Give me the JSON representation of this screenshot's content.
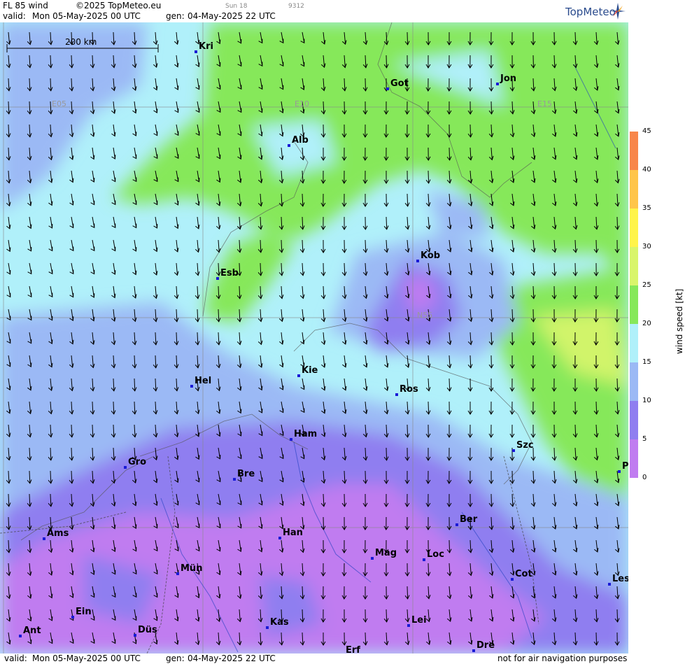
{
  "header": {
    "product": "FL 85 wind",
    "copyright": "©2025 TopMeteo.eu",
    "model_info": "Sun 18",
    "code": "9312",
    "valid_label": "valid:",
    "valid_value": "Mon  05-May-2025  00 UTC",
    "gen_label": "gen:",
    "gen_value": "04-May-2025 22 UTC",
    "logo_text": "TopMeteo"
  },
  "footer": {
    "valid_label": "valid:",
    "valid_value": "Mon  05-May-2025  00 UTC",
    "gen_label": "gen:",
    "gen_value": "04-May-2025 22 UTC",
    "disclaimer": "not for air navigation purposes"
  },
  "scale_bar": {
    "label": "200 km"
  },
  "grid_labels": [
    "E05",
    "E10",
    "E15",
    "N55"
  ],
  "cities": [
    {
      "name": "Kri"
    },
    {
      "name": "Got"
    },
    {
      "name": "Jon"
    },
    {
      "name": "Alb"
    },
    {
      "name": "Esb"
    },
    {
      "name": "Kob"
    },
    {
      "name": "Kie"
    },
    {
      "name": "Hel"
    },
    {
      "name": "Ros"
    },
    {
      "name": "Ham"
    },
    {
      "name": "Szc"
    },
    {
      "name": "Gro"
    },
    {
      "name": "Bre"
    },
    {
      "name": "P"
    },
    {
      "name": "Ams"
    },
    {
      "name": "Han"
    },
    {
      "name": "Ber"
    },
    {
      "name": "Mag"
    },
    {
      "name": "Loc"
    },
    {
      "name": "Mün"
    },
    {
      "name": "Cot"
    },
    {
      "name": "Les"
    },
    {
      "name": "Ein"
    },
    {
      "name": "Kas"
    },
    {
      "name": "Lei"
    },
    {
      "name": "Ant"
    },
    {
      "name": "Düs"
    },
    {
      "name": "Dre"
    },
    {
      "name": "Erf"
    }
  ],
  "legend": {
    "title": "wind speed [kt]",
    "ticks": [
      "45",
      "40",
      "35",
      "30",
      "25",
      "20",
      "15",
      "10",
      "5",
      "0"
    ],
    "colors": {
      "0-5": "#c07cf0",
      "5-10": "#8f7ef0",
      "10-15": "#9bb9f5",
      "15-20": "#b0f0fa",
      "20-25": "#86e85a",
      "25-30": "#d9f56b",
      "30-35": "#fff44a",
      "35-40": "#ffc54a",
      "40-45": "#f8864a",
      "45+": "#f06a5a"
    }
  }
}
